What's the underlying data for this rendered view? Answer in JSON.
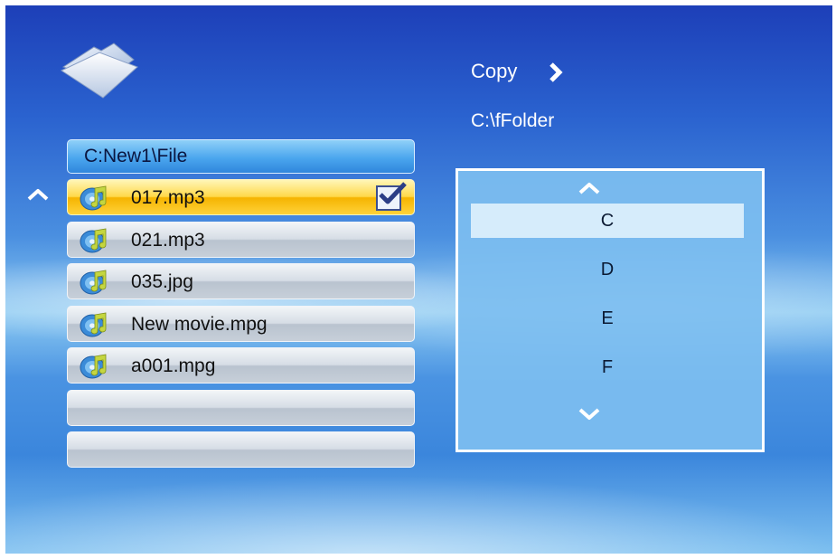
{
  "file_panel": {
    "path": "C:New1\\File",
    "files": [
      {
        "name": "017.mp3",
        "selected": true,
        "checked": true,
        "icon": "music-disc-icon"
      },
      {
        "name": "021.mp3",
        "selected": false,
        "checked": false,
        "icon": "music-disc-icon"
      },
      {
        "name": "035.jpg",
        "selected": false,
        "checked": false,
        "icon": "music-disc-icon"
      },
      {
        "name": "New movie.mpg",
        "selected": false,
        "checked": false,
        "icon": "music-disc-icon"
      },
      {
        "name": "a001.mpg",
        "selected": false,
        "checked": false,
        "icon": "music-disc-icon"
      }
    ],
    "empty_rows": 2
  },
  "action": {
    "label": "Copy",
    "destination": "C:\\fFolder"
  },
  "drive_list": {
    "drives": [
      "C",
      "D",
      "E",
      "F"
    ],
    "selected": "C"
  },
  "colors": {
    "selected_row": "#ffd94a",
    "header_blue": "#4ba6ee",
    "drive_panel": "#7dbef0",
    "drive_highlight": "#d6ecfb"
  }
}
